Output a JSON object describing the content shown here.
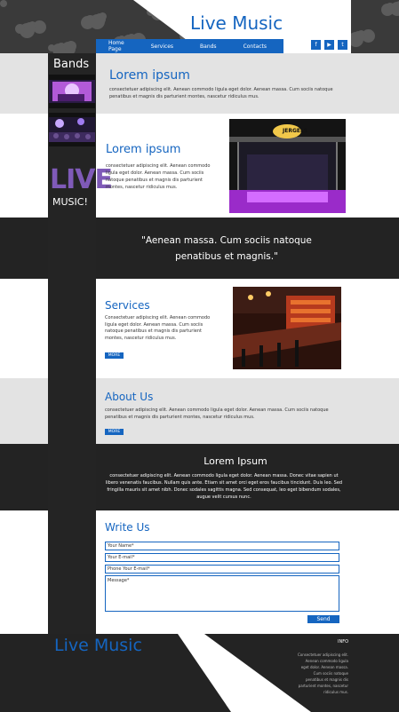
{
  "header": {
    "title": "Live Music"
  },
  "nav": {
    "items": [
      "Home Page",
      "Services",
      "Bands",
      "Contacts"
    ]
  },
  "social": {
    "icons": [
      "facebook-icon",
      "youtube-icon",
      "twitter-icon"
    ],
    "glyphs": [
      "f",
      "▶",
      "t"
    ]
  },
  "bands": {
    "label": "Bands",
    "live": "LIVE",
    "music": "MUSIC!"
  },
  "section1": {
    "title": "Lorem ipsum",
    "text": "consectetuer adipiscing elit. Aenean commodo ligula eget dolor. Aenean massa. Cum sociis natoque penatibus et magnis dis parturient montes, nascetur ridiculus mus."
  },
  "section2": {
    "title": "Lorem ipsum",
    "text": "consectetuer adipiscing elit. Aenean commodo ligula eget dolor. Aenean massa. Cum sociis natoque penatibus et magnis dis parturient montes, nascetur ridiculus mus.",
    "sign": "JERGELS"
  },
  "quote": {
    "text": "\"Aenean massa. Cum sociis natoque penatibus et magnis.\""
  },
  "services": {
    "title": "Services",
    "text": "Consectetuer adipiscing elit. Aenean commodo ligula eget dolor. Aenean massa. Cum sociis natoque penatibus et magnis dis parturient montes, nascetur ridiculus mus.",
    "more": "MORE"
  },
  "about": {
    "title": "About Us",
    "text": "consectetuer adipiscing elit. Aenean commodo ligula eget dolor. Aenean massa. Cum sociis natoque penatibus et magnis dis parturient montes, nascetur ridiculus mus.",
    "more": "MORE"
  },
  "lorem_band": {
    "title": "Lorem Ipsum",
    "text": "consectetuer adipiscing elit. Aenean commodo ligula eget dolor. Aenean massa. Donec vitae sapien ut libero venenatis faucibus. Nullam quis ante. Etiam sit amet orci eget eros faucibus tincidunt. Duis leo. Sed fringilla mauris sit amet nibh. Donec sodales sagittis magna. Sed consequat, leo eget bibendum sodales, augue velit cursus nunc."
  },
  "contact": {
    "title": "Write Us",
    "name_placeholder": "Your Name*",
    "email_placeholder": "Your E-mail*",
    "phone_placeholder": "Phone Your E-mail*",
    "message_placeholder": "Message*",
    "send": "Send"
  },
  "footer": {
    "title": "Live Music",
    "info_title": "INFO",
    "info_text": "Consectetuer adipiscing elit. Aenean commodo ligula eget dolor. Aenean massa. Cum sociis natoque penatibus et magnis dis parturient montes, nascetur ridiculus mus."
  },
  "colors": {
    "accent": "#1565c0",
    "dark": "#232323",
    "light": "#e3e3e3"
  }
}
